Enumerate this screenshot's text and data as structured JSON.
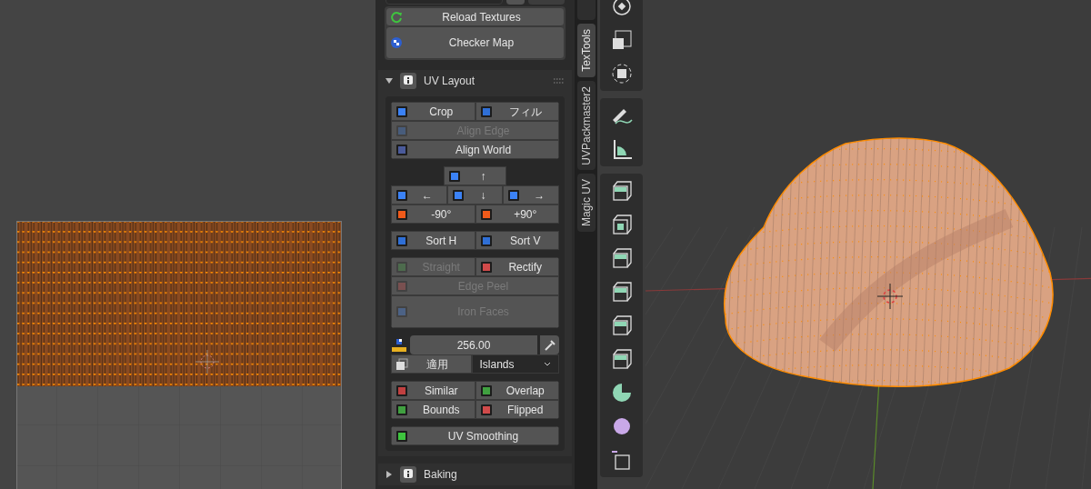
{
  "top_buttons": [
    {
      "label": "Reload Textures"
    },
    {
      "label": "Checker Map"
    }
  ],
  "uv_layout": {
    "title": "UV Layout",
    "expanded": true,
    "transform_rows": [
      [
        {
          "label": "Crop",
          "disabled": false
        },
        {
          "label": "フィル",
          "disabled": false
        }
      ],
      [
        {
          "label": "Align Edge",
          "disabled": true
        }
      ],
      [
        {
          "label": "Align World",
          "disabled": false
        }
      ]
    ],
    "align": {
      "up": "↑",
      "left": "←",
      "down": "↓",
      "right": "→",
      "rotate_left": "-90°",
      "rotate_right": "+90°"
    },
    "sort": [
      {
        "label": "Sort H",
        "disabled": false
      },
      {
        "label": "Sort V",
        "disabled": false
      }
    ],
    "shape_rows": [
      [
        {
          "label": "Straight",
          "disabled": true
        },
        {
          "label": "Rectify",
          "disabled": false
        }
      ],
      [
        {
          "label": "Edge Peel",
          "disabled": true
        }
      ],
      [
        {
          "label": "Iron Faces",
          "disabled": true
        }
      ]
    ],
    "texel": {
      "value": "256.00",
      "apply": "適用",
      "mode": "Islands"
    },
    "select_rows": [
      [
        {
          "label": "Similar",
          "disabled": false
        },
        {
          "label": "Overlap",
          "disabled": false
        }
      ],
      [
        {
          "label": "Bounds",
          "disabled": false
        },
        {
          "label": "Flipped",
          "disabled": false
        }
      ]
    ],
    "smoothing": {
      "label": "UV Smoothing",
      "disabled": false
    }
  },
  "next_panel": {
    "title": "Baking",
    "expanded": false
  },
  "tabs": [
    {
      "label": "TexTools",
      "selected": true
    },
    {
      "label": "UVPackmaster2",
      "selected": false
    },
    {
      "label": "Magic UV",
      "selected": false
    }
  ]
}
